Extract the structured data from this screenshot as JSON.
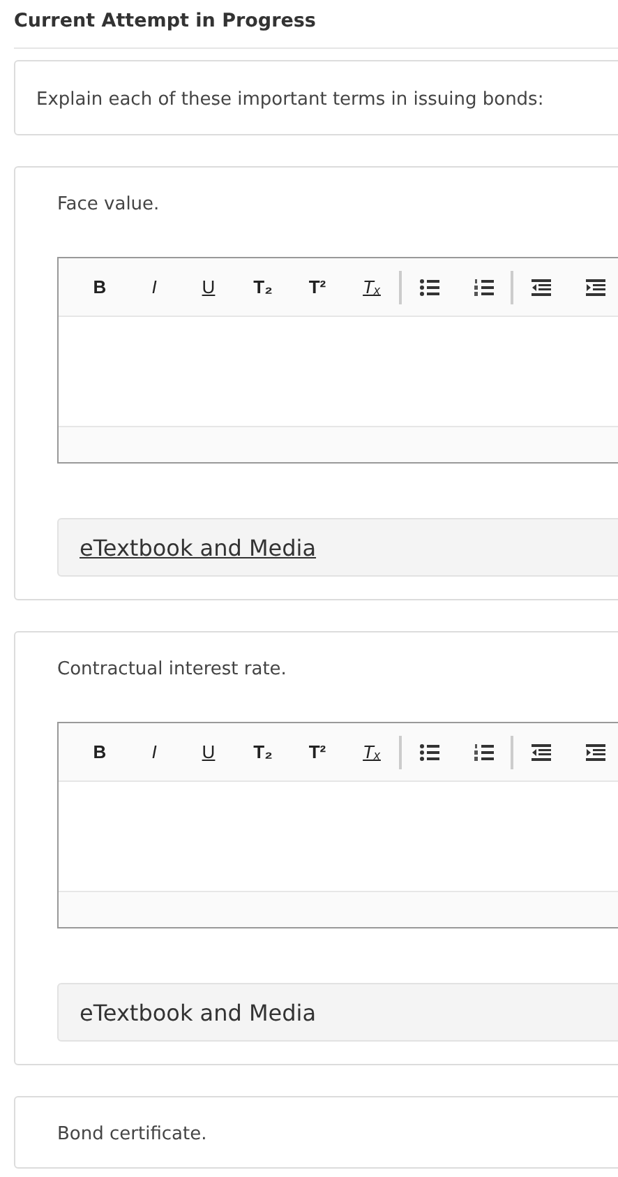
{
  "heading": "Current Attempt in Progress",
  "intro": "Explain each of these important terms in issuing bonds:",
  "questions": [
    {
      "prompt": "Face value.",
      "toolbar": [
        {
          "kind": "bold",
          "label": "B"
        },
        {
          "kind": "italic",
          "label": "I"
        },
        {
          "kind": "underline",
          "label": "U"
        },
        {
          "kind": "subscript",
          "label": "T₂"
        },
        {
          "kind": "superscript",
          "label": "T²"
        },
        {
          "kind": "clear",
          "label": "Tₓ"
        },
        {
          "kind": "separator"
        },
        {
          "kind": "bullets"
        },
        {
          "kind": "numbers"
        },
        {
          "kind": "separator"
        },
        {
          "kind": "outdent"
        },
        {
          "kind": "indent"
        }
      ],
      "resource_link": {
        "label": "eTextbook and Media",
        "focused": true
      }
    },
    {
      "prompt": "Contractual interest rate.",
      "toolbar": [
        {
          "kind": "bold",
          "label": "B"
        },
        {
          "kind": "italic",
          "label": "I"
        },
        {
          "kind": "underline",
          "label": "U"
        },
        {
          "kind": "subscript",
          "label": "T₂"
        },
        {
          "kind": "superscript",
          "label": "T²"
        },
        {
          "kind": "clear",
          "label": "Tₓ"
        },
        {
          "kind": "separator"
        },
        {
          "kind": "bullets"
        },
        {
          "kind": "numbers"
        },
        {
          "kind": "separator"
        },
        {
          "kind": "outdent"
        },
        {
          "kind": "indent"
        }
      ],
      "resource_link": {
        "label": "eTextbook and Media",
        "focused": false
      }
    },
    {
      "prompt": "Bond certificate."
    }
  ]
}
